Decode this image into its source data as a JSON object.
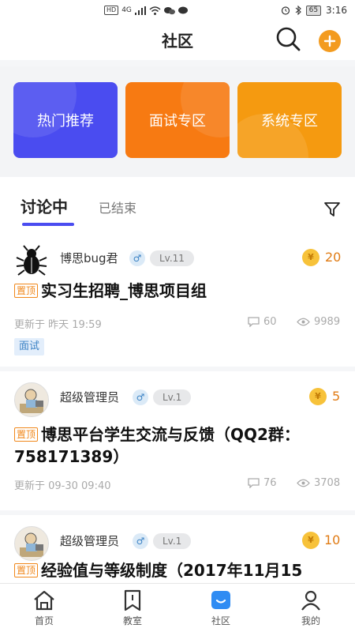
{
  "statusbar": {
    "hd": "HD",
    "net": "4G",
    "battery": "65",
    "time": "3:16"
  },
  "header": {
    "title": "社区"
  },
  "banners": [
    {
      "label": "热门推荐",
      "color": "#4a4cf0"
    },
    {
      "label": "面试专区",
      "color": "#f77a12"
    },
    {
      "label": "系统专区",
      "color": "#f59a10"
    }
  ],
  "tabs": {
    "active": "讨论中",
    "inactive": "已结束"
  },
  "posts": [
    {
      "author": "博思bug君",
      "gender": "♂",
      "level": "Lv.11",
      "coin_symbol": "¥",
      "coins": "20",
      "pin": "置顶",
      "title": "实习生招聘_博思项目组",
      "updated": "更新于 昨天 19:59",
      "comments": "60",
      "views": "9989",
      "tag": "面试"
    },
    {
      "author": "超级管理员",
      "gender": "♂",
      "level": "Lv.1",
      "coin_symbol": "¥",
      "coins": "5",
      "pin": "置顶",
      "title": "博思平台学生交流与反馈（QQ2群：758171389）",
      "updated": "更新于 09-30 09:40",
      "comments": "76",
      "views": "3708"
    },
    {
      "author": "超级管理员",
      "gender": "♂",
      "level": "Lv.1",
      "coin_symbol": "¥",
      "coins": "10",
      "pin": "置顶",
      "title": "经验值与等级制度（2017年11月15"
    }
  ],
  "nav": [
    {
      "label": "首页",
      "icon": "home-icon"
    },
    {
      "label": "教室",
      "icon": "classroom-icon"
    },
    {
      "label": "社区",
      "icon": "community-icon",
      "active": true
    },
    {
      "label": "我的",
      "icon": "profile-icon"
    }
  ],
  "colors": {
    "accent": "#4a4cf0",
    "orange": "#f39b1f",
    "coin": "#f7c23a"
  }
}
